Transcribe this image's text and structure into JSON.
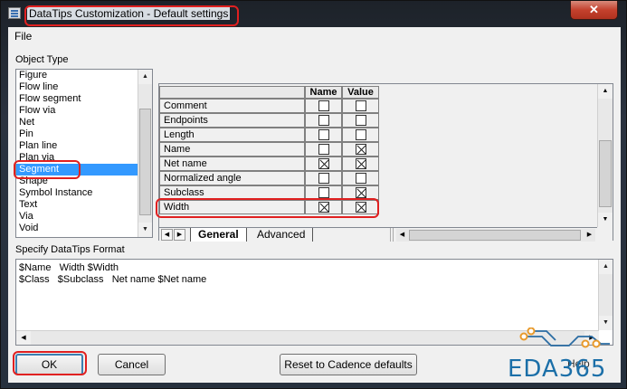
{
  "window": {
    "title": "DataTips Customization -  Default settings",
    "close_glyph": "✕"
  },
  "menu": {
    "file": "File"
  },
  "object_type": {
    "label": "Object Type",
    "items": [
      "Figure",
      "Flow line",
      "Flow segment",
      "Flow via",
      "Net",
      "Pin",
      "Plan line",
      "Plan via",
      "Segment",
      "Shape",
      "Symbol Instance",
      "Text",
      "Via",
      "Void"
    ],
    "selected": "Segment"
  },
  "grid": {
    "col_name": "Name",
    "col_value": "Value",
    "rows": [
      {
        "label": "Comment",
        "name": false,
        "value": false
      },
      {
        "label": "Endpoints",
        "name": false,
        "value": false
      },
      {
        "label": "Length",
        "name": false,
        "value": false
      },
      {
        "label": "Name",
        "name": false,
        "value": true
      },
      {
        "label": "Net name",
        "name": true,
        "value": true
      },
      {
        "label": "Normalized angle",
        "name": false,
        "value": false
      },
      {
        "label": "Subclass",
        "name": false,
        "value": true
      },
      {
        "label": "Width",
        "name": true,
        "value": true
      }
    ],
    "tabs": [
      "General",
      "Advanced"
    ],
    "active_tab": "General"
  },
  "format": {
    "label": "Specify DataTips Format",
    "lines": [
      "$Name   Width $Width",
      "$Class   $Subclass   Net name $Net name"
    ]
  },
  "buttons": {
    "ok": "OK",
    "cancel": "Cancel",
    "reset": "Reset to Cadence defaults",
    "help": "Help"
  },
  "watermark": {
    "text": "EDA365"
  },
  "colors": {
    "highlight": "#e02020",
    "selection": "#3399ff",
    "watermark": "#1b6fa8",
    "close": "#c4412d"
  }
}
